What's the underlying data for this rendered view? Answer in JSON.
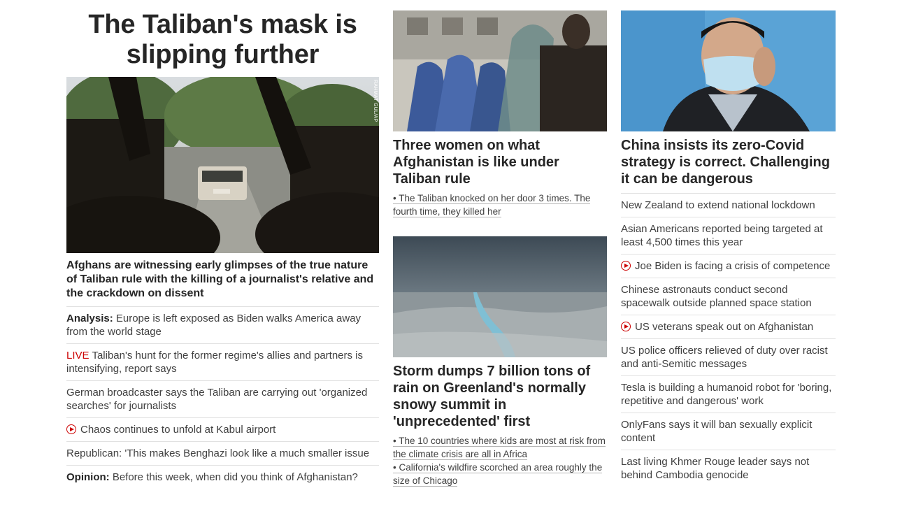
{
  "left": {
    "title": "The Taliban's mask is slipping further",
    "photo_credit": "RAHMAT GUL/AP",
    "lead_headline": "Afghans are witnessing early glimpses of the true nature of Taliban rule with the killing of a journalist's relative and the crackdown on dissent",
    "items": [
      {
        "prefix": "Analysis:",
        "text": "Europe is left exposed as Biden walks America away from the world stage"
      },
      {
        "live": "LIVE",
        "text": "Taliban's hunt for the former regime's allies and partners is intensifying, report says"
      },
      {
        "text": "German broadcaster says the Taliban are carrying out 'organized searches' for journalists"
      },
      {
        "video": true,
        "text": "Chaos continues to unfold at Kabul airport"
      },
      {
        "text": "Republican: 'This makes Benghazi look like a much smaller issue"
      },
      {
        "prefix": "Opinion:",
        "text": "Before this week, when did you think of Afghanistan?"
      }
    ]
  },
  "middle": {
    "card1": {
      "headline": "Three women on what Afghanistan is like under Taliban rule",
      "sublinks": [
        "• The Taliban knocked on her door 3 times. The fourth time, they killed her"
      ]
    },
    "card2": {
      "headline": "Storm dumps 7 billion tons of rain on Greenland's normally snowy summit in 'unprecedented' first",
      "sublinks": [
        "• The 10 countries where kids are most at risk from the climate crisis are all in Africa",
        "• California's wildfire scorched an area roughly the size of Chicago"
      ]
    }
  },
  "right": {
    "headline": "China insists its zero-Covid strategy is correct. Challenging it can be dangerous",
    "items": [
      {
        "text": "New Zealand to extend national lockdown"
      },
      {
        "text": "Asian Americans reported being targeted at least 4,500 times this year"
      },
      {
        "video": true,
        "text": "Joe Biden is facing a crisis of competence"
      },
      {
        "text": "Chinese astronauts conduct second spacewalk outside planned space station"
      },
      {
        "video": true,
        "text": "US veterans speak out on Afghanistan"
      },
      {
        "text": "US police officers relieved of duty over racist and anti-Semitic messages"
      },
      {
        "text": "Tesla is building a humanoid robot for 'boring, repetitive and dangerous' work"
      },
      {
        "text": "OnlyFans says it will ban sexually explicit content"
      },
      {
        "text": "Last living Khmer Rouge leader says not behind Cambodia genocide"
      }
    ]
  },
  "colors": {
    "live": "#cc0000",
    "text": "#262626",
    "divider": "#e1e1e1"
  }
}
